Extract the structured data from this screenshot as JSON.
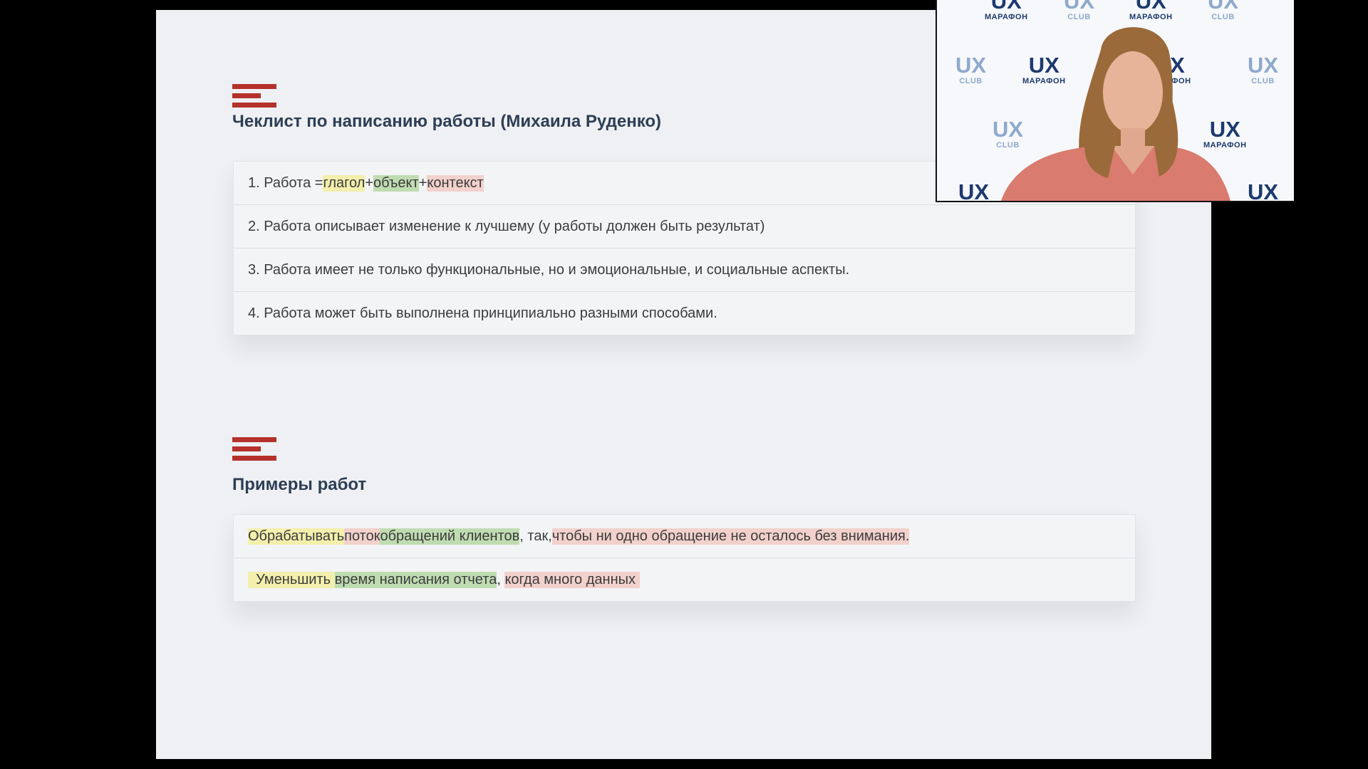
{
  "section1": {
    "title": "Чеклист по написанию работы (Михаила Руденко)",
    "item1": {
      "prefix": "1. Работа = ",
      "verb": "глагол",
      "plus1": " + ",
      "object": "объект",
      "plus2": " + ",
      "context": "контекст"
    },
    "item2": "2. Работа описывает изменение к лучшему (у работы должен быть результат)",
    "item3": "3. Работа имеет не только функциональные, но и эмоциональные, и социальные аспекты.",
    "item4": "4. Работа может быть выполнена принципиально разными способами."
  },
  "section2": {
    "title": "Примеры работ",
    "ex1": {
      "verb": "Обрабатывать",
      "sp1": " ",
      "obj1": "поток",
      "sp2": " ",
      "obj2": "обращений клиентов",
      "mid": ", так, ",
      "ctx": "чтобы ни одно обращение не осталось без внимания."
    },
    "ex2": {
      "verb": "  Уменьшить ",
      "obj": "время написания отчета",
      "comma": ", ",
      "ctx": "когда много данных "
    }
  },
  "video": {
    "watermark_big": "UX",
    "watermark_dark_small": "МАРАФОН",
    "watermark_light_small": "CLUB"
  },
  "colors": {
    "accent": "#b5312c",
    "highlight_verb": "#f3efac",
    "highlight_object": "#bfdcb1",
    "highlight_context": "#f2d1cc"
  }
}
